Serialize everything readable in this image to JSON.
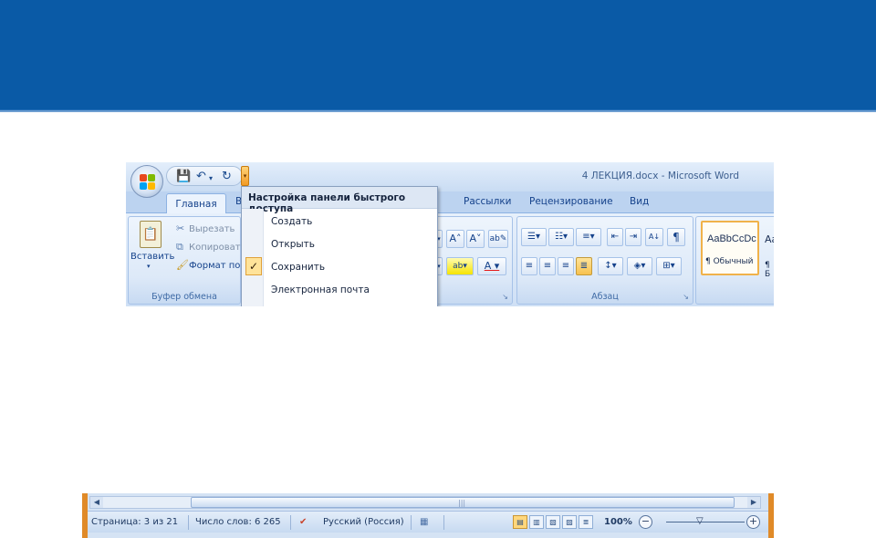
{
  "window": {
    "title": "4 ЛЕКЦИЯ.docx - Microsoft Word"
  },
  "ribbon": {
    "tabs": [
      "Главная",
      "В",
      "Рассылки",
      "Рецензирование",
      "Вид"
    ],
    "clipboard": {
      "paste_label": "Вставить",
      "cut": "Вырезать",
      "copy": "Копироват",
      "format": "Формат по",
      "group_label": "Буфер обмена"
    },
    "paragraph": {
      "group_label": "Абзац"
    },
    "styles": {
      "sample": "AaBbCcDc",
      "name": "¶ Обычный",
      "next_sample": "Aa",
      "next_name": "¶ Б"
    }
  },
  "qat_menu": {
    "header": "Настройка панели быстрого доступа",
    "items": [
      "Создать",
      "Открыть",
      "Сохранить",
      "Электронная почта"
    ],
    "checked": "Сохранить"
  },
  "status": {
    "page": "Страница: 3 из 21",
    "words": "Число слов: 6 265",
    "language": "Русский (Россия)",
    "zoom": "100%"
  },
  "colors": {
    "banner": "#0a5aa6",
    "accent": "#f29a24",
    "ribbon": "#cfe0f5"
  }
}
